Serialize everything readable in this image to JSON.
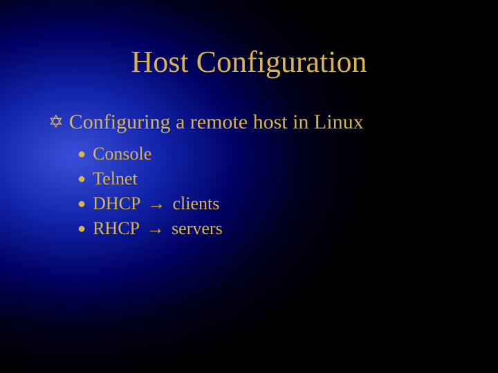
{
  "slide": {
    "title": "Host Configuration",
    "level1": {
      "bullet_glyph": "✡",
      "text": "Configuring a remote host in Linux"
    },
    "level2": {
      "bullet_glyph": "●",
      "items": [
        {
          "label": "Console",
          "arrow": "",
          "target": ""
        },
        {
          "label": "Telnet",
          "arrow": "",
          "target": ""
        },
        {
          "label": "DHCP",
          "arrow": "→",
          "target": "clients"
        },
        {
          "label": "RHCP",
          "arrow": "→",
          "target": "servers"
        }
      ]
    }
  }
}
